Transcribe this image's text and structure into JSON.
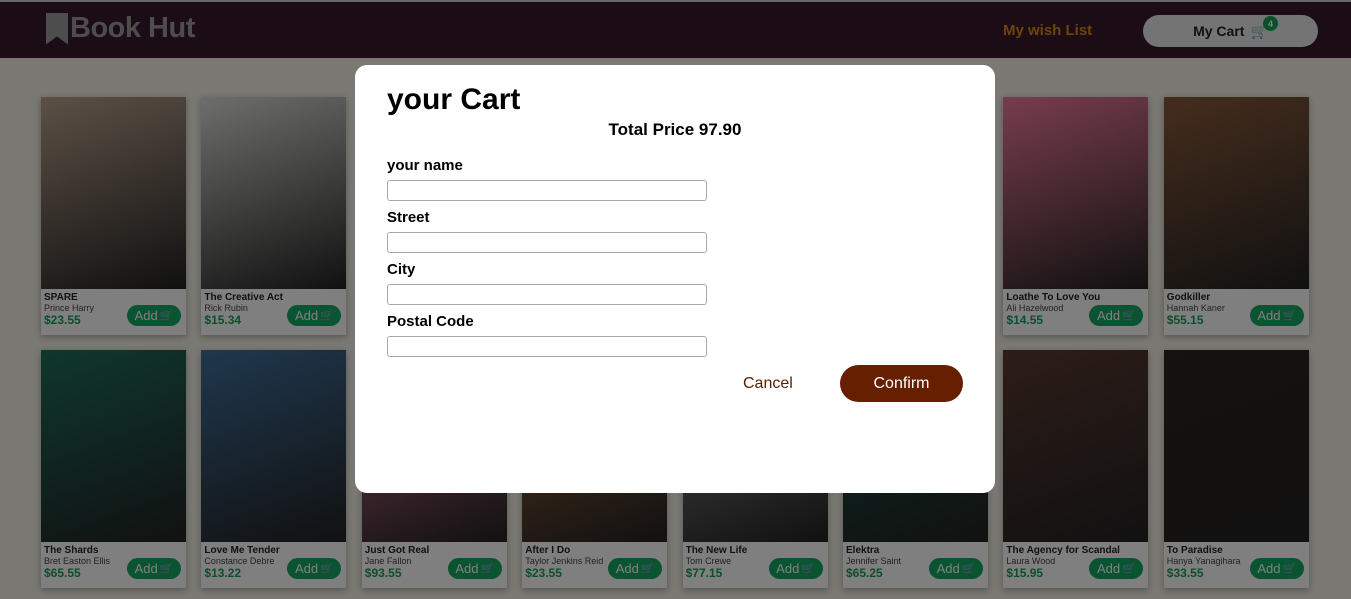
{
  "header": {
    "brand": "Book Hut",
    "wishlist": "My wish List",
    "cart_label": "My Cart",
    "cart_count": "4"
  },
  "books": [
    {
      "title": "SPARE",
      "author": "Prince Harry",
      "price": "$23.55",
      "color": "#b9a08c"
    },
    {
      "title": "The Creative Act",
      "author": "Rick Rubin",
      "price": "$15.34",
      "color": "#dcdcd8"
    },
    {
      "title": "",
      "author": "",
      "price": "",
      "color": "#ccc"
    },
    {
      "title": "",
      "author": "",
      "price": "",
      "color": "#ccc"
    },
    {
      "title": "",
      "author": "",
      "price": "",
      "color": "#ccc"
    },
    {
      "title": "",
      "author": "",
      "price": "",
      "color": "#ccc"
    },
    {
      "title": "Loathe To Love You",
      "author": "Ali Hazelwood",
      "price": "$14.55",
      "color": "#f07a9a"
    },
    {
      "title": "Godkiller",
      "author": "Hannah Kaner",
      "price": "$55.15",
      "color": "#8a5a3a"
    },
    {
      "title": "The Shards",
      "author": "Bret Easton Ellis",
      "price": "$65.55",
      "color": "#1e6e5a"
    },
    {
      "title": "Love Me Tender",
      "author": "Constance Debre",
      "price": "$13.22",
      "color": "#3f6f9a"
    },
    {
      "title": "Just Got Real",
      "author": "Jane Fallon",
      "price": "$93.55",
      "color": "#e07aa0"
    },
    {
      "title": "After I Do",
      "author": "Taylor Jenkins Reid",
      "price": "$23.55",
      "color": "#b07040"
    },
    {
      "title": "The New Life",
      "author": "Tom Crewe",
      "price": "$77.15",
      "color": "#9a9a9a"
    },
    {
      "title": "Elektra",
      "author": "Jennifer Saint",
      "price": "$65.25",
      "color": "#1a5a4a"
    },
    {
      "title": "The Agency for Scandal",
      "author": "Laura Wood",
      "price": "$15.95",
      "color": "#5a3a30"
    },
    {
      "title": "To Paradise",
      "author": "Hanya Yanagihara",
      "price": "$33.55",
      "color": "#2a2420"
    }
  ],
  "add_label": "Add",
  "modal": {
    "title": "your Cart",
    "total": "Total Price 97.90",
    "fields": [
      {
        "label": "your name",
        "value": ""
      },
      {
        "label": "Street",
        "value": ""
      },
      {
        "label": "City",
        "value": ""
      },
      {
        "label": "Postal Code",
        "value": ""
      }
    ],
    "cancel": "Cancel",
    "confirm": "Confirm"
  }
}
